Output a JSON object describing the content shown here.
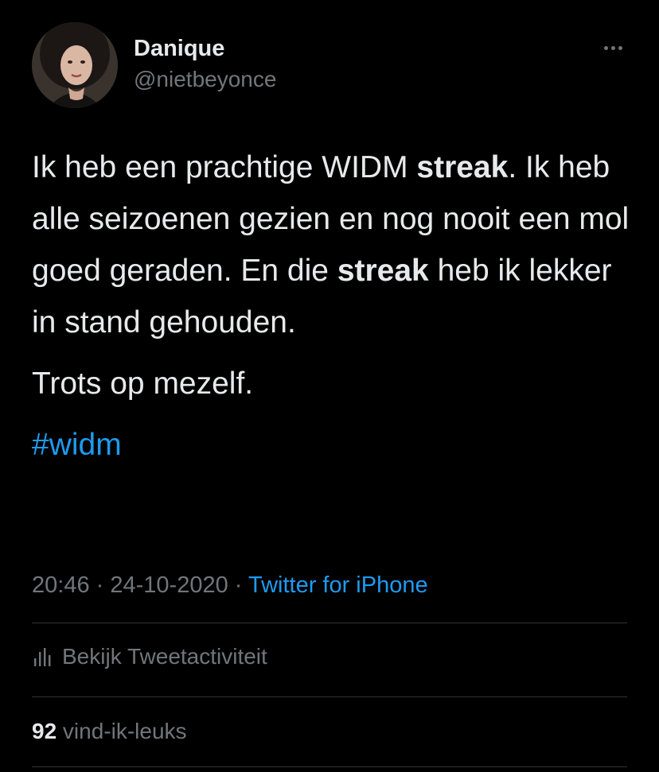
{
  "author": {
    "name": "Danique",
    "handle": "@nietbeyonce"
  },
  "tweet": {
    "p1_a": "Ik heb een prachtige WIDM ",
    "p1_b": "streak",
    "p1_c": ". Ik heb alle seizoenen gezien en nog nooit een mol goed geraden. En die ",
    "p1_d": "streak",
    "p1_e": " heb ik lekker in stand gehouden.",
    "p2": "Trots op mezelf.",
    "hashtag": "#widm"
  },
  "meta": {
    "time": "20:46",
    "sep1": " · ",
    "date": "24-10-2020",
    "sep2": " · ",
    "source": "Twitter for iPhone"
  },
  "activity": {
    "label": "Bekijk Tweetactiviteit"
  },
  "likes": {
    "count": "92",
    "label": " vind-ik-leuks"
  },
  "colors": {
    "background": "#000000",
    "text": "#e7e9ea",
    "secondary": "#71767b",
    "link": "#1d9bf0",
    "divider": "#2f3336"
  },
  "icons": {
    "more": "more-horizontal-icon",
    "activity": "bar-chart-icon"
  }
}
